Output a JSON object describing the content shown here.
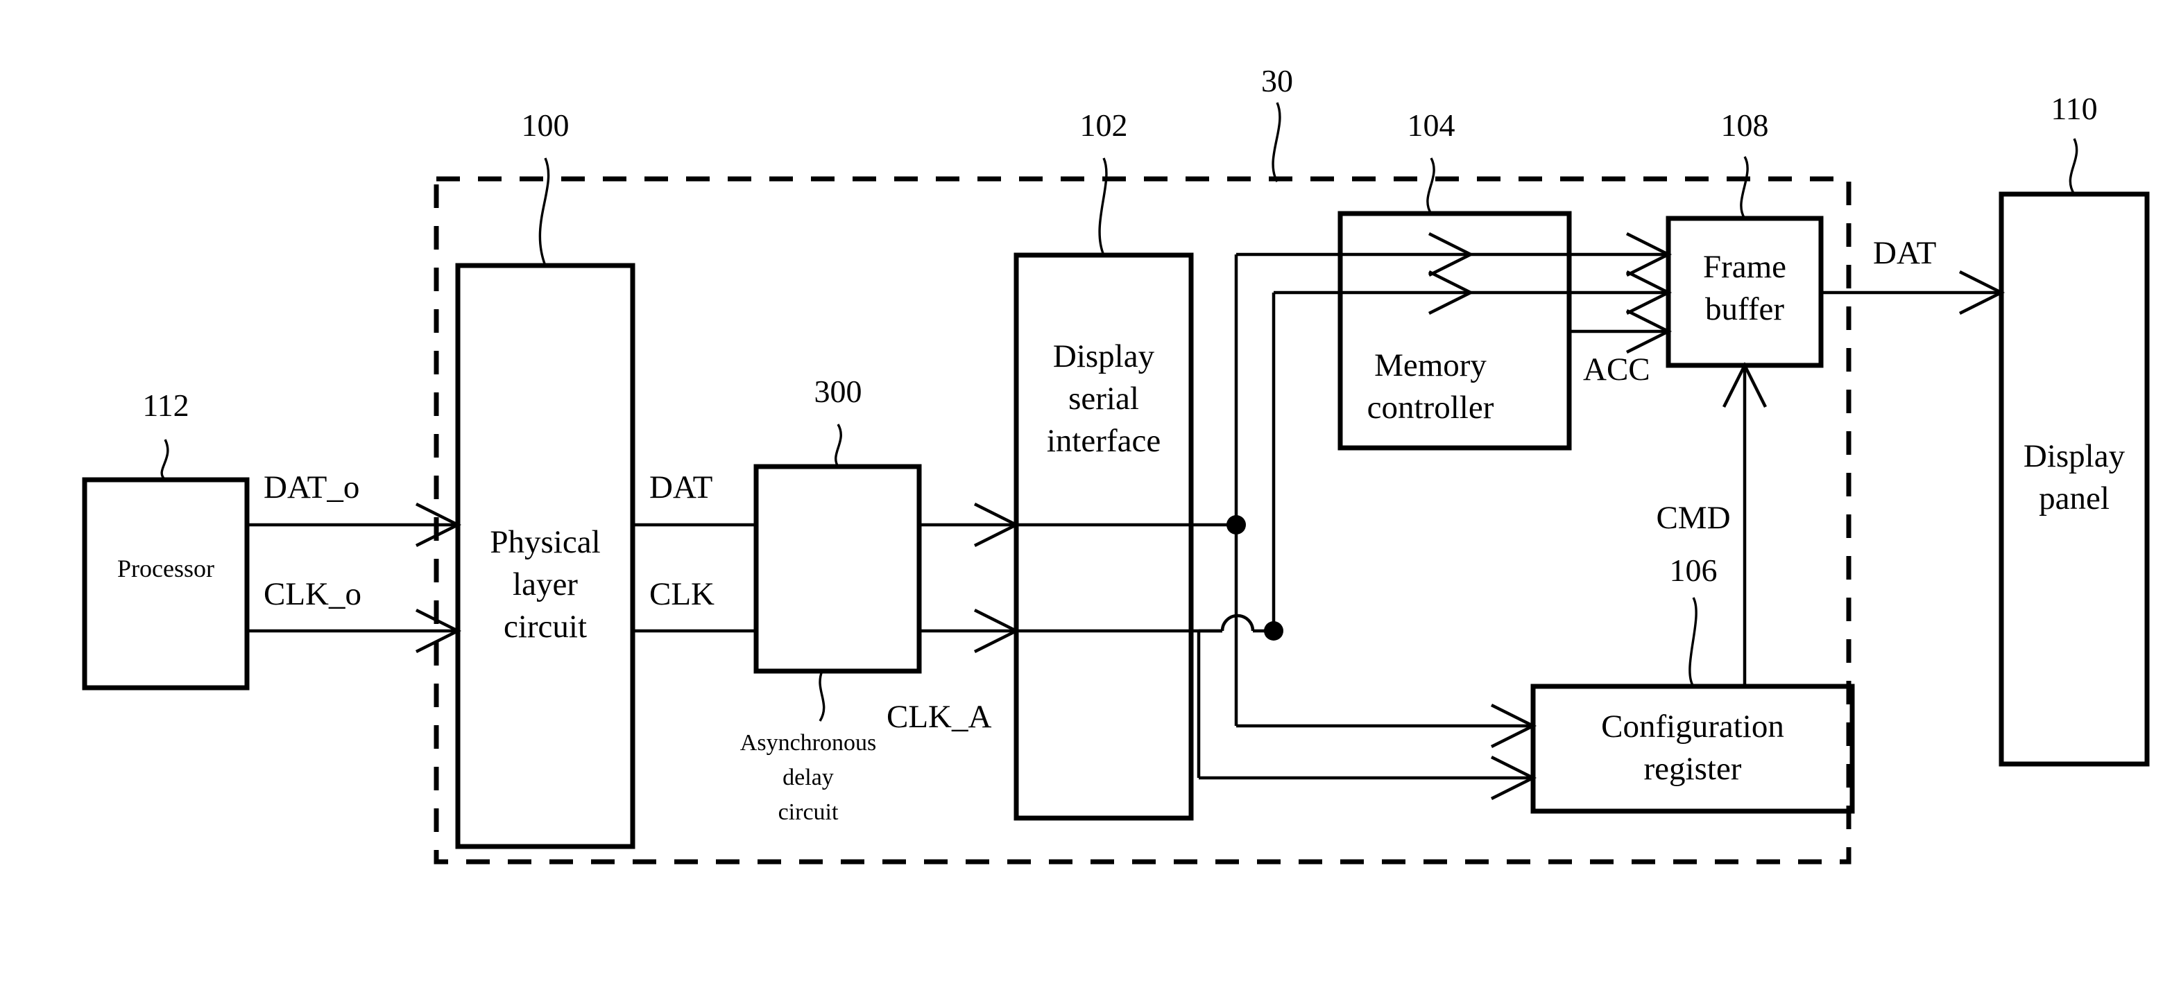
{
  "figure": {
    "type": "patent-block-diagram",
    "background_color": "#ffffff",
    "line_color": "#000000"
  },
  "boundary": {
    "label": "30",
    "style": "dashed",
    "name": "display-driver-boundary"
  },
  "blocks": {
    "processor": {
      "label": "Processor",
      "ref": "112"
    },
    "physical_layer": {
      "line1": "Physical",
      "line2": "layer",
      "line3": "circuit",
      "ref": "100"
    },
    "delay_circuit": {
      "ref": "300",
      "note1": "Asynchronous",
      "note2": "delay",
      "note3": "circuit"
    },
    "display_serial_interface": {
      "line1": "Display",
      "line2": "serial",
      "line3": "interface",
      "ref": "102"
    },
    "memory_controller": {
      "line1": "Memory",
      "line2": "controller",
      "ref": "104"
    },
    "frame_buffer": {
      "line1": "Frame",
      "line2": "buffer",
      "ref": "108"
    },
    "configuration_register": {
      "line1": "Configuration",
      "line2": "register",
      "ref": "106"
    },
    "display_panel": {
      "line1": "Display",
      "line2": "panel",
      "ref": "110"
    }
  },
  "signals": {
    "dat_o": "DAT_o",
    "clk_o": "CLK_o",
    "dat": "DAT",
    "clk": "CLK",
    "clk_a": "CLK_A",
    "acc": "ACC",
    "cmd": "CMD",
    "dat_out": "DAT"
  }
}
